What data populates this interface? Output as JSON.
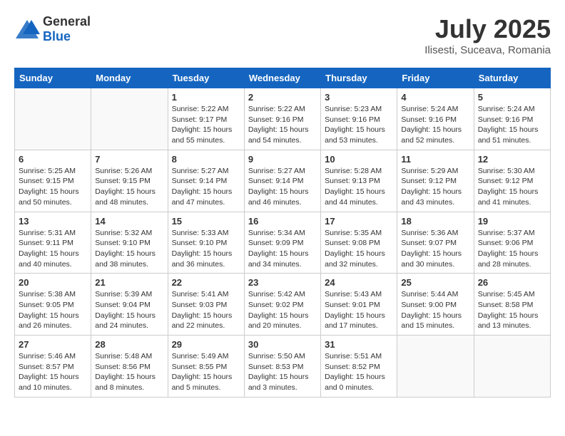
{
  "header": {
    "logo_general": "General",
    "logo_blue": "Blue",
    "month": "July 2025",
    "location": "Ilisesti, Suceava, Romania"
  },
  "columns": [
    "Sunday",
    "Monday",
    "Tuesday",
    "Wednesday",
    "Thursday",
    "Friday",
    "Saturday"
  ],
  "weeks": [
    [
      {
        "day": "",
        "info": ""
      },
      {
        "day": "",
        "info": ""
      },
      {
        "day": "1",
        "info": "Sunrise: 5:22 AM\nSunset: 9:17 PM\nDaylight: 15 hours\nand 55 minutes."
      },
      {
        "day": "2",
        "info": "Sunrise: 5:22 AM\nSunset: 9:16 PM\nDaylight: 15 hours\nand 54 minutes."
      },
      {
        "day": "3",
        "info": "Sunrise: 5:23 AM\nSunset: 9:16 PM\nDaylight: 15 hours\nand 53 minutes."
      },
      {
        "day": "4",
        "info": "Sunrise: 5:24 AM\nSunset: 9:16 PM\nDaylight: 15 hours\nand 52 minutes."
      },
      {
        "day": "5",
        "info": "Sunrise: 5:24 AM\nSunset: 9:16 PM\nDaylight: 15 hours\nand 51 minutes."
      }
    ],
    [
      {
        "day": "6",
        "info": "Sunrise: 5:25 AM\nSunset: 9:15 PM\nDaylight: 15 hours\nand 50 minutes."
      },
      {
        "day": "7",
        "info": "Sunrise: 5:26 AM\nSunset: 9:15 PM\nDaylight: 15 hours\nand 48 minutes."
      },
      {
        "day": "8",
        "info": "Sunrise: 5:27 AM\nSunset: 9:14 PM\nDaylight: 15 hours\nand 47 minutes."
      },
      {
        "day": "9",
        "info": "Sunrise: 5:27 AM\nSunset: 9:14 PM\nDaylight: 15 hours\nand 46 minutes."
      },
      {
        "day": "10",
        "info": "Sunrise: 5:28 AM\nSunset: 9:13 PM\nDaylight: 15 hours\nand 44 minutes."
      },
      {
        "day": "11",
        "info": "Sunrise: 5:29 AM\nSunset: 9:12 PM\nDaylight: 15 hours\nand 43 minutes."
      },
      {
        "day": "12",
        "info": "Sunrise: 5:30 AM\nSunset: 9:12 PM\nDaylight: 15 hours\nand 41 minutes."
      }
    ],
    [
      {
        "day": "13",
        "info": "Sunrise: 5:31 AM\nSunset: 9:11 PM\nDaylight: 15 hours\nand 40 minutes."
      },
      {
        "day": "14",
        "info": "Sunrise: 5:32 AM\nSunset: 9:10 PM\nDaylight: 15 hours\nand 38 minutes."
      },
      {
        "day": "15",
        "info": "Sunrise: 5:33 AM\nSunset: 9:10 PM\nDaylight: 15 hours\nand 36 minutes."
      },
      {
        "day": "16",
        "info": "Sunrise: 5:34 AM\nSunset: 9:09 PM\nDaylight: 15 hours\nand 34 minutes."
      },
      {
        "day": "17",
        "info": "Sunrise: 5:35 AM\nSunset: 9:08 PM\nDaylight: 15 hours\nand 32 minutes."
      },
      {
        "day": "18",
        "info": "Sunrise: 5:36 AM\nSunset: 9:07 PM\nDaylight: 15 hours\nand 30 minutes."
      },
      {
        "day": "19",
        "info": "Sunrise: 5:37 AM\nSunset: 9:06 PM\nDaylight: 15 hours\nand 28 minutes."
      }
    ],
    [
      {
        "day": "20",
        "info": "Sunrise: 5:38 AM\nSunset: 9:05 PM\nDaylight: 15 hours\nand 26 minutes."
      },
      {
        "day": "21",
        "info": "Sunrise: 5:39 AM\nSunset: 9:04 PM\nDaylight: 15 hours\nand 24 minutes."
      },
      {
        "day": "22",
        "info": "Sunrise: 5:41 AM\nSunset: 9:03 PM\nDaylight: 15 hours\nand 22 minutes."
      },
      {
        "day": "23",
        "info": "Sunrise: 5:42 AM\nSunset: 9:02 PM\nDaylight: 15 hours\nand 20 minutes."
      },
      {
        "day": "24",
        "info": "Sunrise: 5:43 AM\nSunset: 9:01 PM\nDaylight: 15 hours\nand 17 minutes."
      },
      {
        "day": "25",
        "info": "Sunrise: 5:44 AM\nSunset: 9:00 PM\nDaylight: 15 hours\nand 15 minutes."
      },
      {
        "day": "26",
        "info": "Sunrise: 5:45 AM\nSunset: 8:58 PM\nDaylight: 15 hours\nand 13 minutes."
      }
    ],
    [
      {
        "day": "27",
        "info": "Sunrise: 5:46 AM\nSunset: 8:57 PM\nDaylight: 15 hours\nand 10 minutes."
      },
      {
        "day": "28",
        "info": "Sunrise: 5:48 AM\nSunset: 8:56 PM\nDaylight: 15 hours\nand 8 minutes."
      },
      {
        "day": "29",
        "info": "Sunrise: 5:49 AM\nSunset: 8:55 PM\nDaylight: 15 hours\nand 5 minutes."
      },
      {
        "day": "30",
        "info": "Sunrise: 5:50 AM\nSunset: 8:53 PM\nDaylight: 15 hours\nand 3 minutes."
      },
      {
        "day": "31",
        "info": "Sunrise: 5:51 AM\nSunset: 8:52 PM\nDaylight: 15 hours\nand 0 minutes."
      },
      {
        "day": "",
        "info": ""
      },
      {
        "day": "",
        "info": ""
      }
    ]
  ]
}
